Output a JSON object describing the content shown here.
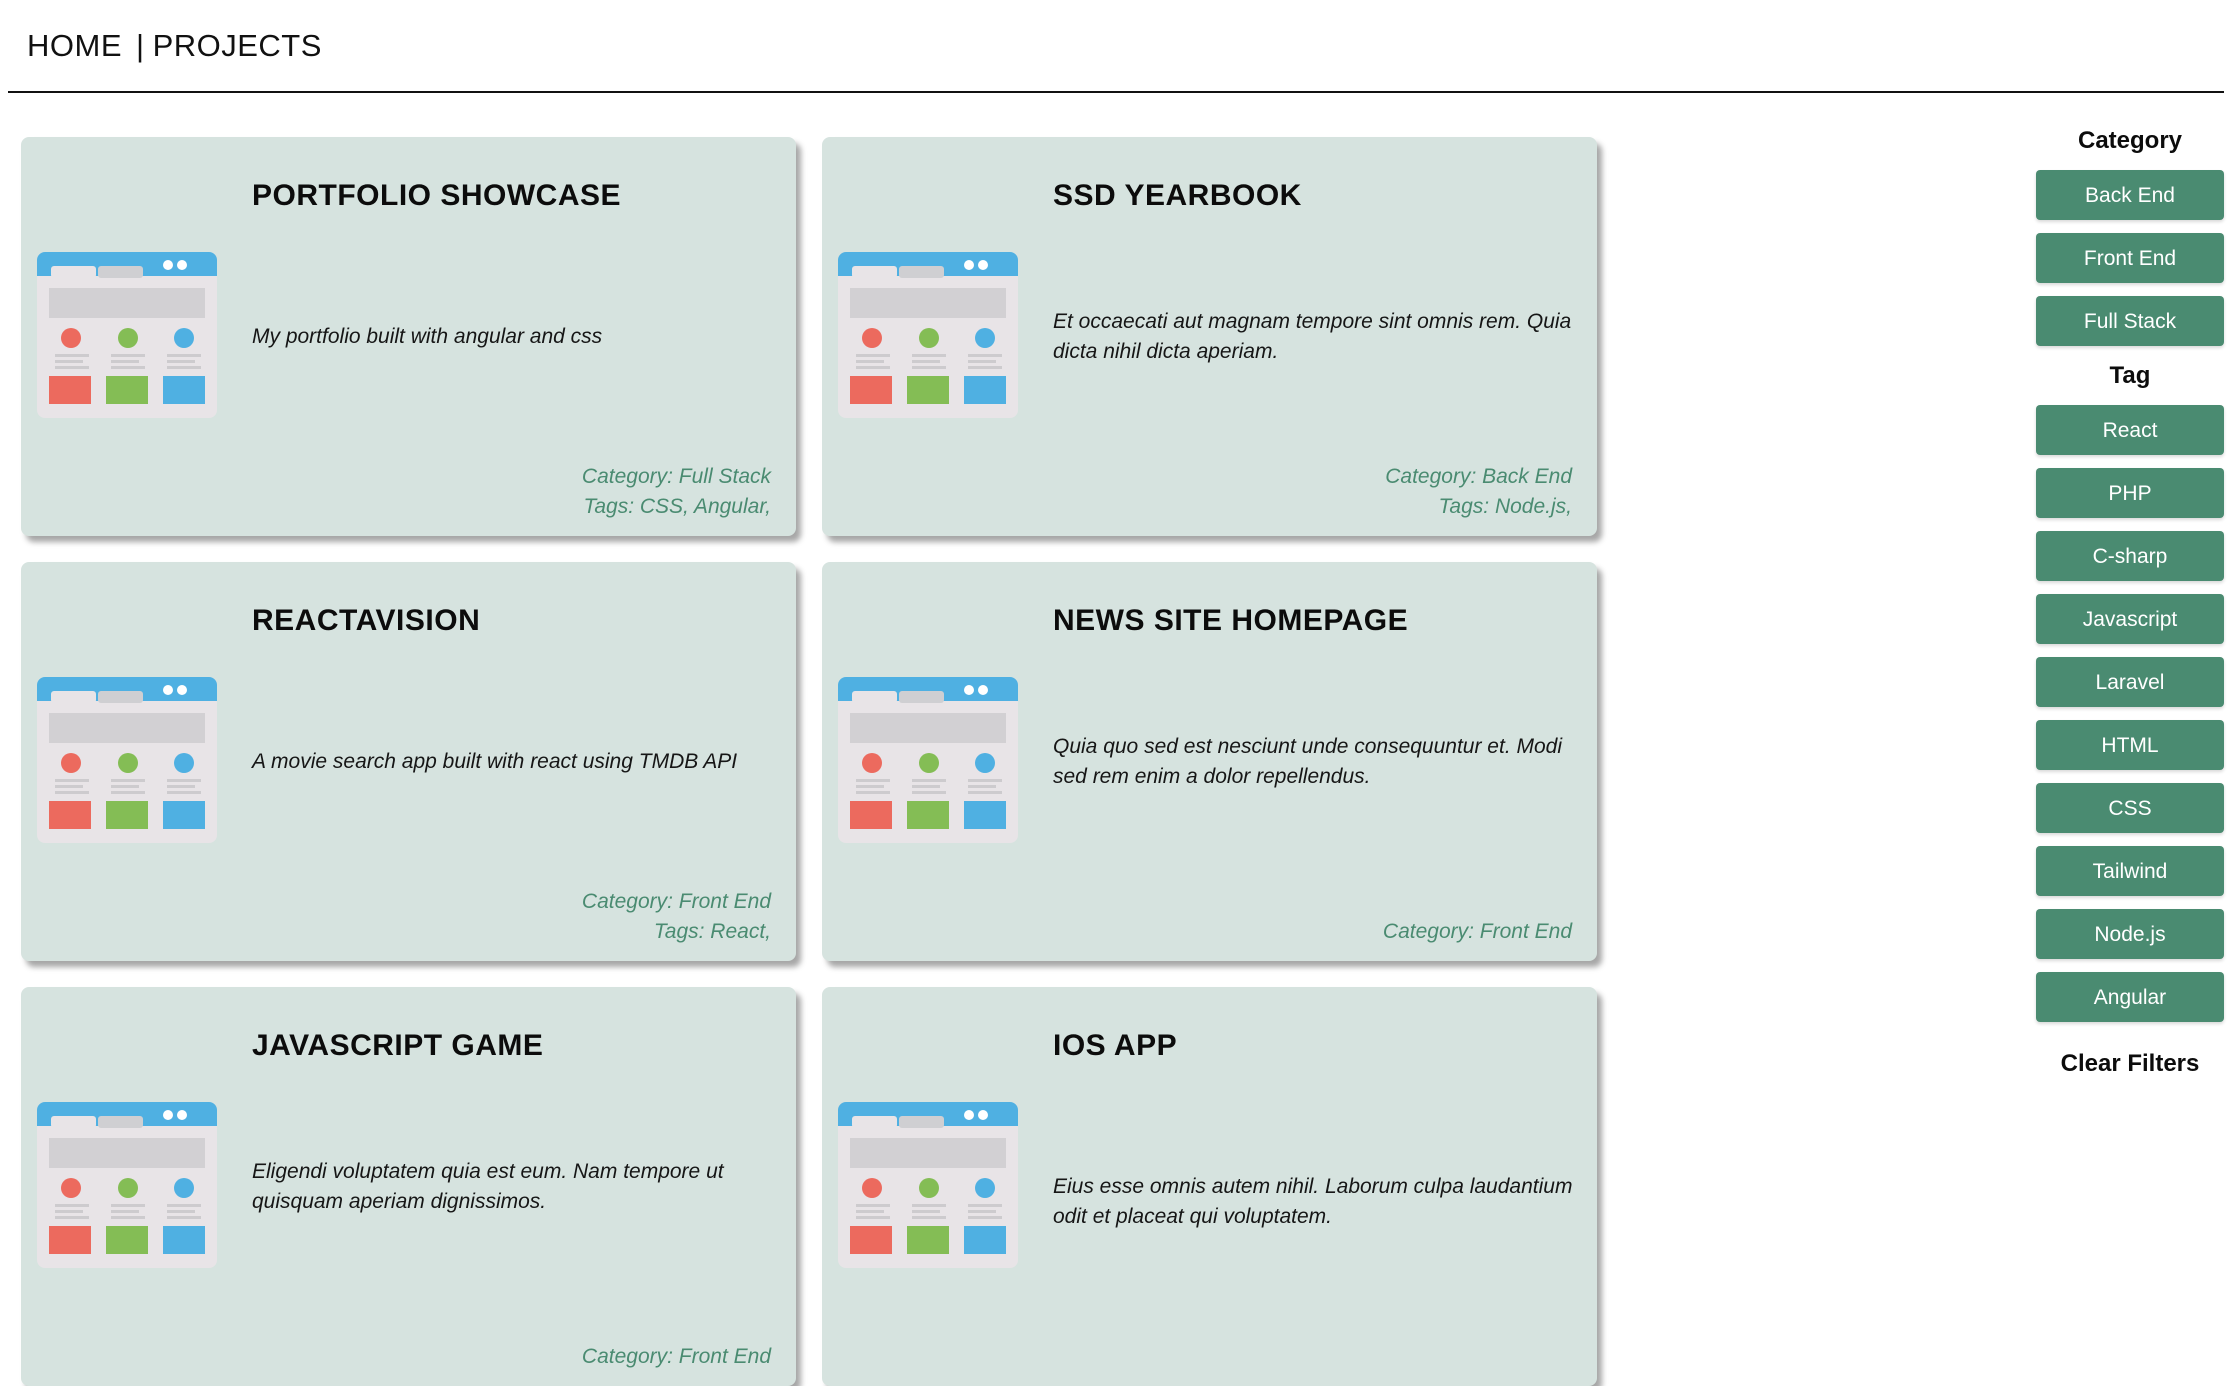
{
  "nav": {
    "home": "HOME",
    "separator": "|",
    "projects": "PROJECTS"
  },
  "colors": {
    "card_bg": "#d6e3df",
    "accent": "#4a8b71",
    "browser_blue": "#4fb0e2"
  },
  "projects": [
    {
      "title": "PORTFOLIO SHOWCASE",
      "description": "My portfolio built with angular and css",
      "category": "Category: Full Stack",
      "tags": "Tags: CSS, Angular,"
    },
    {
      "title": "SSD YEARBOOK",
      "description": "Et occaecati aut magnam tempore sint omnis rem. Quia dicta nihil dicta aperiam.",
      "category": "Category: Back End",
      "tags": "Tags: Node.js,"
    },
    {
      "title": "REACTAVISION",
      "description": "A movie search app built with react using TMDB API",
      "category": "Category: Front End",
      "tags": "Tags: React,"
    },
    {
      "title": "NEWS SITE HOMEPAGE",
      "description": "Quia quo sed est nesciunt unde consequuntur et. Modi sed rem enim a dolor repellendus.",
      "category": "Category: Front End",
      "tags": ""
    },
    {
      "title": "JAVASCRIPT GAME",
      "description": "Eligendi voluptatem quia est eum. Nam tempore ut quisquam aperiam dignissimos.",
      "category": "Category: Front End",
      "tags": ""
    },
    {
      "title": "IOS APP",
      "description": "Eius esse omnis autem nihil. Laborum culpa laudantium odit et placeat qui voluptatem.",
      "category": "",
      "tags": ""
    }
  ],
  "filters": {
    "category_heading": "Category",
    "categories": [
      "Back End",
      "Front End",
      "Full Stack"
    ],
    "tag_heading": "Tag",
    "tags": [
      "React",
      "PHP",
      "C-sharp",
      "Javascript",
      "Laravel",
      "HTML",
      "CSS",
      "Tailwind",
      "Node.js",
      "Angular"
    ],
    "clear_label": "Clear Filters"
  },
  "thumbnail_icon": "browser-window-icon"
}
